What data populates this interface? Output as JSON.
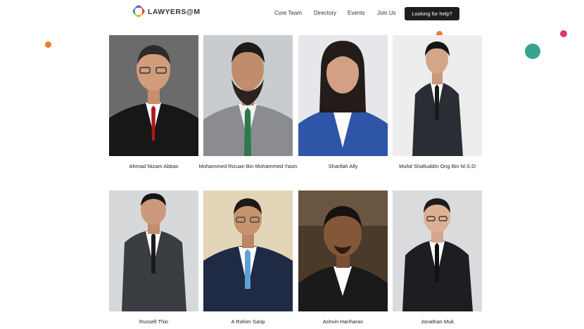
{
  "header": {
    "logo_text": "LAWYERS@M",
    "nav": [
      {
        "label": "Core Team"
      },
      {
        "label": "Directory"
      },
      {
        "label": "Events"
      },
      {
        "label": "Join Us"
      }
    ],
    "cta_label": "Looking for help?"
  },
  "colors": {
    "accent_orange": "#ef7d2b",
    "accent_teal": "#3aa38f",
    "accent_pink": "#e8336e",
    "cta_bg": "#1e1e1e"
  },
  "members": [
    {
      "name": "Ahmad Nizam Abbas"
    },
    {
      "name": "Mohammed Rizuan Bin Mohammed Yasin"
    },
    {
      "name": "Sharifah Ally"
    },
    {
      "name": "Muhd Shafiuddin Ong Bin M.S.O"
    },
    {
      "name": "Russell Thio"
    },
    {
      "name": "A Rohim Sarip"
    },
    {
      "name": "Ashvin Hariharan"
    },
    {
      "name": "Jonathan Muk"
    }
  ]
}
